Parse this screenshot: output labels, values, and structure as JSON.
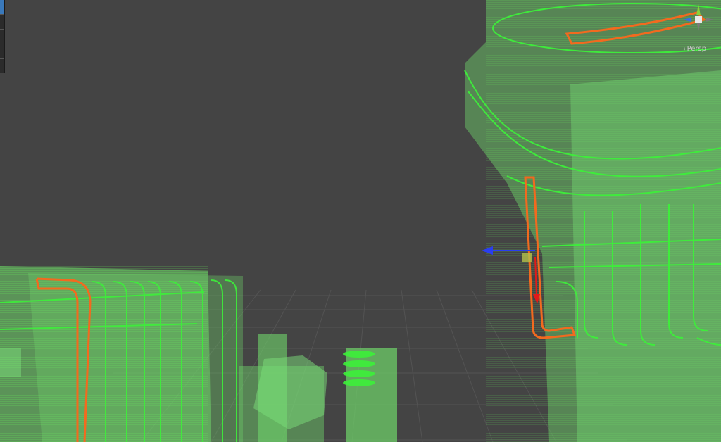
{
  "scene_view": {
    "projection_label": "Persp",
    "projection_icon": "chevron-left-icon"
  },
  "gizmo": {
    "icon": "orientation-gizmo-icon",
    "axis_colors": {
      "x": "#e03a3a",
      "y": "#8ad13a",
      "z": "#3a6ce8"
    }
  },
  "colors": {
    "background": "#444444",
    "grid": "#5a5a5a",
    "mesh_fill": "#6fd56a",
    "mesh_wire": "#3df03a",
    "selection_outline": "#f26a1f",
    "handle_blue": "#2a3ef0",
    "handle_red": "#e01a1a"
  }
}
